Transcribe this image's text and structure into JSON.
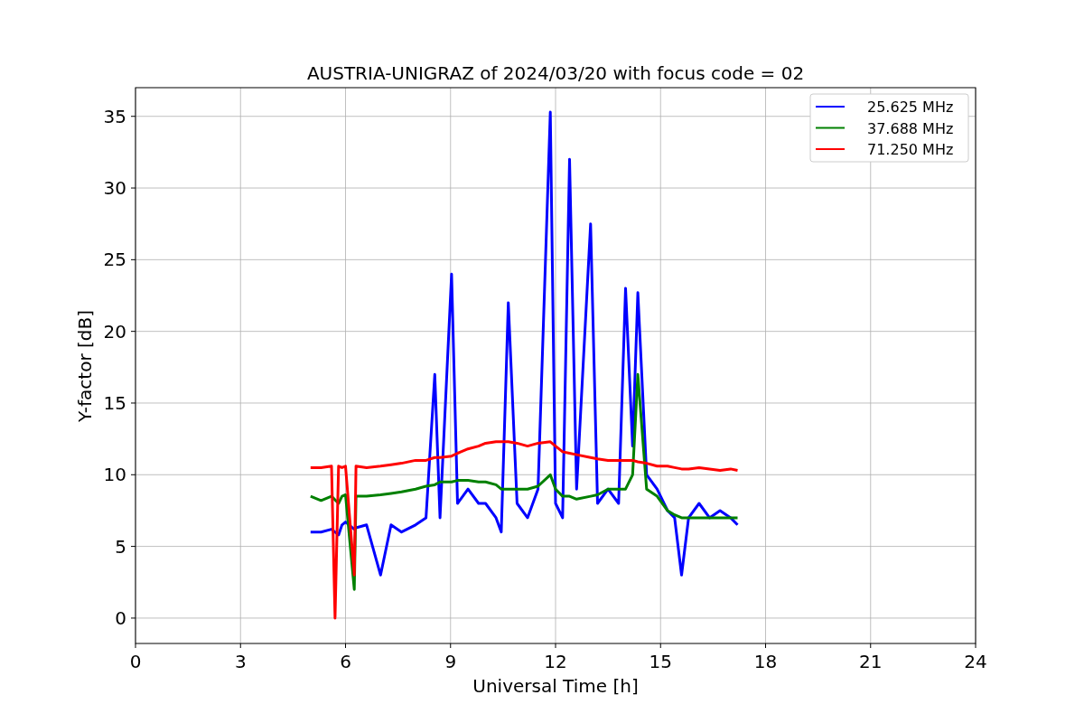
{
  "chart_data": {
    "type": "line",
    "title": "AUSTRIA-UNIGRAZ of 2024/03/20 with focus code = 02",
    "xlabel": "Universal Time [h]",
    "ylabel": "Y-factor [dB]",
    "x": [
      5.0,
      5.3,
      5.6,
      5.7,
      5.8,
      5.9,
      6.0,
      6.25,
      6.3,
      6.6,
      7.0,
      7.3,
      7.6,
      8.0,
      8.3,
      8.55,
      8.7,
      9.03,
      9.2,
      9.5,
      9.8,
      10.0,
      10.3,
      10.45,
      10.65,
      10.9,
      11.2,
      11.5,
      11.85,
      12.0,
      12.2,
      12.4,
      12.6,
      13.0,
      13.2,
      13.5,
      13.8,
      14.0,
      14.2,
      14.35,
      14.6,
      14.9,
      15.2,
      15.4,
      15.6,
      15.8,
      16.1,
      16.4,
      16.7,
      17.0,
      17.2
    ],
    "series": [
      {
        "name": "25.625 MHz",
        "color": "#0000ff",
        "values": [
          6,
          6,
          6.2,
          null,
          5.8,
          6.5,
          6.7,
          6.2,
          6.3,
          6.5,
          3,
          6.5,
          6,
          6.5,
          7,
          17,
          7,
          24,
          8,
          9,
          8,
          8,
          7,
          6,
          22,
          8,
          7,
          9,
          35.3,
          8,
          7,
          32,
          9,
          27.5,
          8,
          9,
          8,
          23,
          12,
          22.7,
          10,
          9,
          7.5,
          7,
          3,
          7,
          8,
          7,
          7.5,
          7,
          6.5
        ]
      },
      {
        "name": "37.688 MHz",
        "color": "#008000",
        "values": [
          8.5,
          8.2,
          8.5,
          null,
          8,
          8.5,
          8.6,
          2,
          8.5,
          8.5,
          8.6,
          8.7,
          8.8,
          9,
          9.2,
          9.3,
          9.5,
          9.5,
          9.6,
          9.6,
          9.5,
          9.5,
          9.3,
          9,
          9,
          9,
          9,
          9.2,
          10,
          9,
          8.5,
          8.5,
          8.3,
          8.5,
          8.6,
          9,
          9,
          9,
          10,
          17,
          9,
          8.5,
          7.5,
          7.2,
          7,
          7,
          7,
          7,
          7,
          7,
          7
        ]
      },
      {
        "name": "71.250 MHz",
        "color": "#ff0000",
        "values": [
          10.5,
          10.5,
          10.6,
          0,
          10.6,
          10.5,
          10.6,
          3,
          10.6,
          10.5,
          10.6,
          10.7,
          10.8,
          11,
          11,
          11.2,
          11.2,
          11.3,
          11.5,
          11.8,
          12,
          12.2,
          12.3,
          12.3,
          12.3,
          12.2,
          12,
          12.2,
          12.3,
          12,
          11.6,
          11.5,
          11.4,
          11.2,
          11.1,
          11,
          11,
          11,
          11,
          10.9,
          10.8,
          10.6,
          10.6,
          10.5,
          10.4,
          10.4,
          10.5,
          10.4,
          10.3,
          10.4,
          10.3
        ]
      }
    ],
    "grid": true,
    "legend": true,
    "xlim": [
      0,
      24
    ],
    "ylim": [
      -1.77,
      37
    ],
    "xticks": [
      0,
      3,
      6,
      9,
      12,
      15,
      18,
      21,
      24
    ],
    "yticks": [
      0,
      5,
      10,
      15,
      20,
      25,
      30,
      35
    ]
  }
}
